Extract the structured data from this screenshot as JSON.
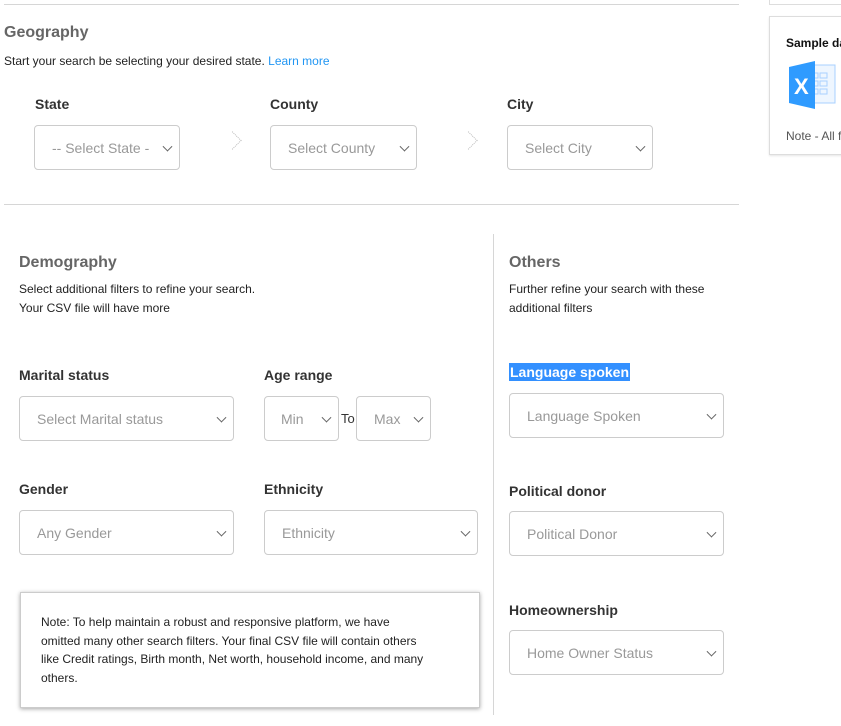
{
  "geography": {
    "title": "Geography",
    "subtitle": "Start your search be selecting your desired state.",
    "learn_more": "Learn more",
    "state": {
      "label": "State",
      "placeholder": "-- Select State -"
    },
    "county": {
      "label": "County",
      "placeholder": "Select County"
    },
    "city": {
      "label": "City",
      "placeholder": "Select City"
    }
  },
  "demography": {
    "title": "Demography",
    "line1": "Select additional filters to refine your search.",
    "line2": "Your CSV file will have more",
    "marital": {
      "label": "Marital status",
      "placeholder": "Select Marital status"
    },
    "age": {
      "label": "Age range",
      "min": "Min",
      "to": "To",
      "max": "Max"
    },
    "gender": {
      "label": "Gender",
      "placeholder": "Any Gender"
    },
    "ethnicity": {
      "label": "Ethnicity",
      "placeholder": "Ethnicity"
    },
    "note": [
      "Note: To help maintain a robust and responsive platform, we have",
      "omitted many other search filters. Your final CSV file will contain others",
      "like Credit ratings, Birth month, Net worth, household income, and many",
      "others."
    ]
  },
  "others": {
    "title": "Others",
    "line1": "Further refine your search with these",
    "line2": "additional filters",
    "language": {
      "label": "Language spoken",
      "placeholder": "Language Spoken"
    },
    "donor": {
      "label": "Political donor",
      "placeholder": "Political Donor"
    },
    "home": {
      "label": "Homeownership",
      "placeholder": "Home Owner Status"
    }
  },
  "sample": {
    "title": "Sample da",
    "note": "Note - All f",
    "icon": "excel-icon"
  },
  "colors": {
    "link": "#2196f3",
    "highlight": "#3390ff",
    "excel": "#2f9bff"
  }
}
